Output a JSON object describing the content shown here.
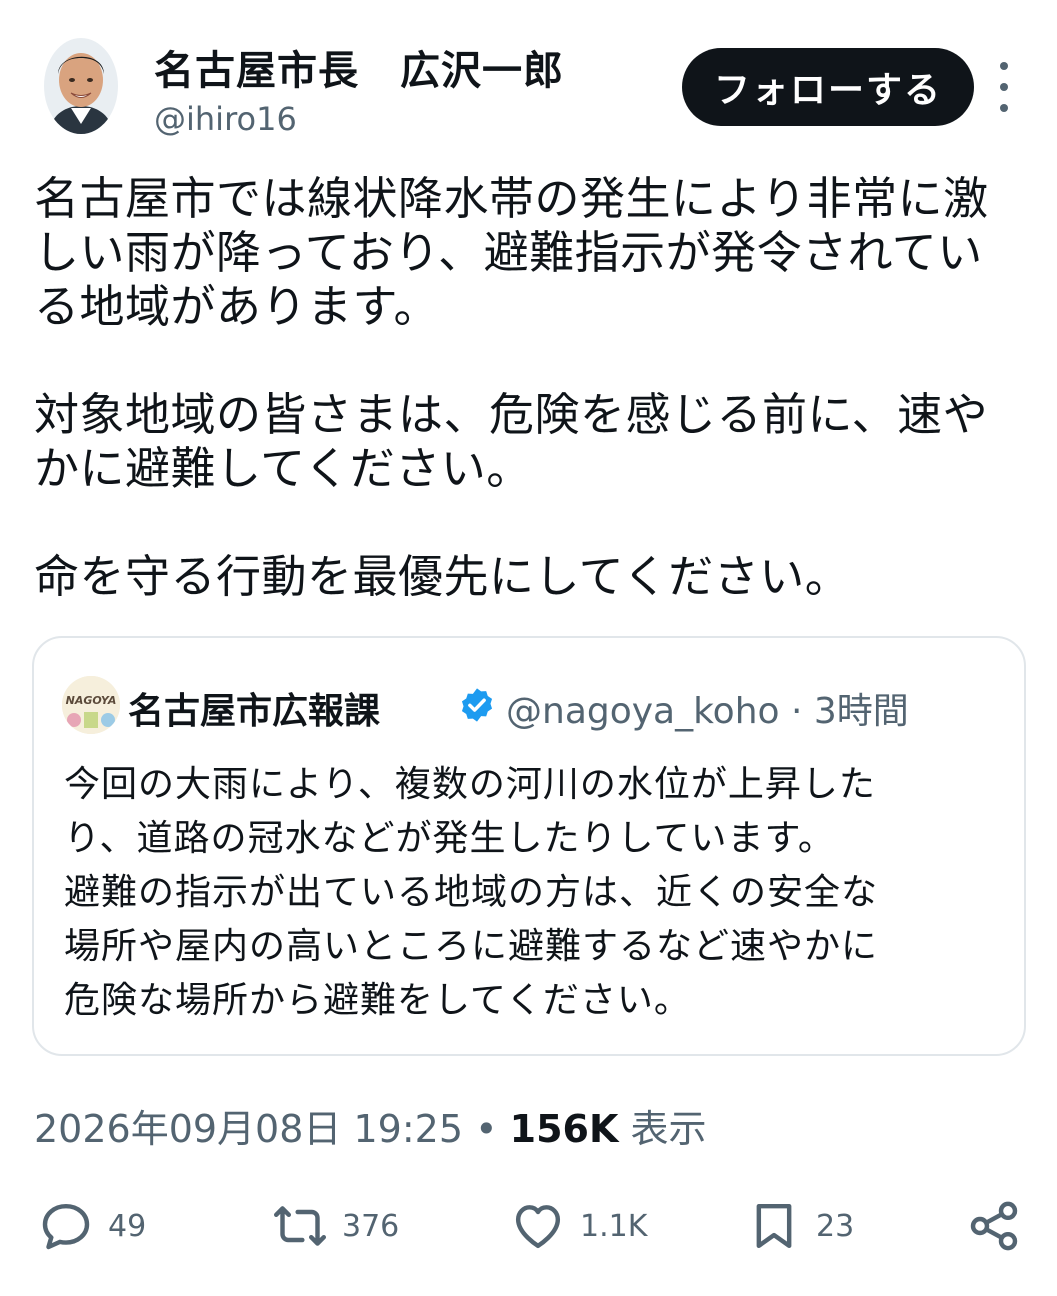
{
  "author": {
    "display_name": "名古屋市長　広沢一郎",
    "handle": "@ihiro16",
    "follow_label": "フォローする"
  },
  "tweet": {
    "paragraphs": [
      "名古屋市では線状降水帯の発生により非常に激\nしい雨が降っており、避難指示が発令されてい\nる地域があります。",
      "対象地域の皆さまは、危険を感じる前に、速や\nかに避難してください。",
      "命を守る行動を最優先にしてください。"
    ]
  },
  "quote": {
    "avatar_text": "NAGOYA",
    "display_name": "名古屋市広報課",
    "meta": "@nagoya_koho · 3時間",
    "text": "今回の大雨により、複数の河川の水位が上昇した\nり、道路の冠水などが発生したりしています。\n避難の指示が出ている地域の方は、近くの安全な\n場所や屋内の高いところに避難するなど速やかに\n危険な場所から避難をしてください。"
  },
  "timestamp": {
    "datetime": "2026年09月08日 19:25",
    "separator": "•",
    "views": "156K",
    "views_label": "表示"
  },
  "actions": {
    "replies": "49",
    "reposts": "376",
    "likes": "1.1K",
    "bookmarks": "23"
  },
  "colors": {
    "text": "#0f1419",
    "secondary": "#536471",
    "border": "#e1e6ea",
    "verified": "#1d9bf0"
  }
}
